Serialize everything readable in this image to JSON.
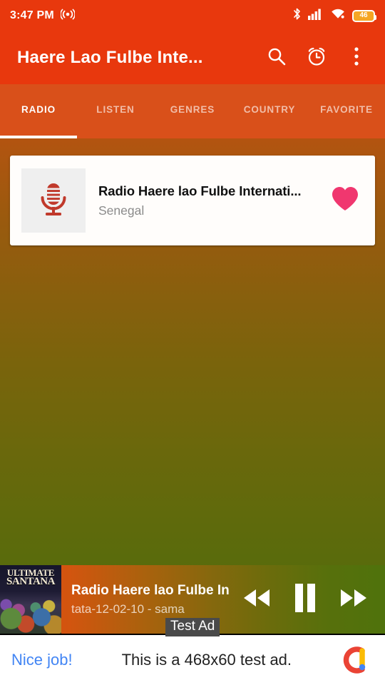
{
  "status_bar": {
    "time": "3:47 PM",
    "cast_icon": "broadcast-icon",
    "bluetooth_icon": "bluetooth-icon",
    "signal_icon": "cellular-signal-icon",
    "wifi_icon": "wifi-icon",
    "battery_level": "46"
  },
  "app_bar": {
    "title": "Haere Lao Fulbe Inte...",
    "search_icon": "search-icon",
    "alarm_icon": "alarm-clock-icon",
    "overflow_icon": "more-vertical-icon"
  },
  "tabs": {
    "items": [
      {
        "label": "RADIO",
        "active": true
      },
      {
        "label": "LISTEN",
        "active": false
      },
      {
        "label": "GENRES",
        "active": false
      },
      {
        "label": "COUNTRY",
        "active": false
      },
      {
        "label": "FAVORITE",
        "active": false
      }
    ]
  },
  "station_card": {
    "thumb_icon": "microphone-icon",
    "title": "Radio Haere lao Fulbe Internati...",
    "country": "Senegal",
    "favorite_icon": "heart-filled-icon",
    "favorite_color": "#f0376f"
  },
  "player": {
    "album_art_line1": "ULTIMATE",
    "album_art_line2": "SANTANA",
    "title": "Radio Haere lao Fulbe In...",
    "subtitle": "tata-12-02-10 - sama",
    "prev_icon": "rewind-icon",
    "play_icon": "pause-icon",
    "next_icon": "fast-forward-icon"
  },
  "ad": {
    "badge": "Test Ad",
    "cta": "Nice job!",
    "body": "This is a 468x60 test ad.",
    "logo_icon": "admob-logo-icon"
  },
  "theme": {
    "primary": "#e8380d",
    "tab_bar": "#d9501a",
    "accent_pink": "#f0376f",
    "ad_link_blue": "#4285f4"
  }
}
